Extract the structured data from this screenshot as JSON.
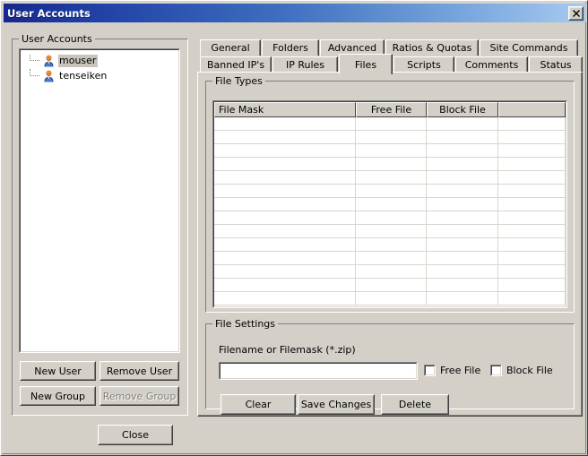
{
  "window": {
    "title": "User Accounts",
    "close_label": "✕",
    "titlebar_gradient_from": "#16288c",
    "titlebar_gradient_to": "#a8caf0",
    "face_color": "#d4d0c8"
  },
  "user_accounts": {
    "legend": "User Accounts",
    "items": [
      {
        "label": "mouser",
        "selected": true,
        "icon": "user-icon"
      },
      {
        "label": "tenseiken",
        "selected": false,
        "icon": "user-icon"
      }
    ],
    "buttons": [
      {
        "label": "New User",
        "disabled": false
      },
      {
        "label": "Remove User",
        "disabled": false
      },
      {
        "label": "New Group",
        "disabled": false
      },
      {
        "label": "Remove Group",
        "disabled": true
      }
    ]
  },
  "dialog_buttons": [
    {
      "label": "Close",
      "disabled": false
    }
  ],
  "tabs": {
    "row1": [
      {
        "label": "General",
        "active": false
      },
      {
        "label": "Folders",
        "active": false
      },
      {
        "label": "Advanced",
        "active": false
      },
      {
        "label": "Ratios & Quotas",
        "active": false
      },
      {
        "label": "Site Commands",
        "active": false
      }
    ],
    "row2": [
      {
        "label": "Banned IP's",
        "active": false
      },
      {
        "label": "IP Rules",
        "active": false
      },
      {
        "label": "Files",
        "active": true
      },
      {
        "label": "Scripts",
        "active": false
      },
      {
        "label": "Comments",
        "active": false
      },
      {
        "label": "Status",
        "active": false
      }
    ],
    "selected": "Files"
  },
  "file_types": {
    "legend": "File Types",
    "columns": [
      "File Mask",
      "Free File",
      "Block File",
      ""
    ],
    "rows": [],
    "empty_row_count": 14
  },
  "file_settings": {
    "legend": "File Settings",
    "filemask_label": "Filename or Filemask (*.zip)",
    "filemask_value": "",
    "filemask_placeholder": "",
    "checkboxes": [
      {
        "label": "Free File",
        "checked": false
      },
      {
        "label": "Block File",
        "checked": false
      }
    ],
    "buttons": [
      {
        "label": "Clear",
        "disabled": false
      },
      {
        "label": "Save Changes",
        "disabled": false
      },
      {
        "label": "Delete",
        "disabled": false
      }
    ]
  }
}
